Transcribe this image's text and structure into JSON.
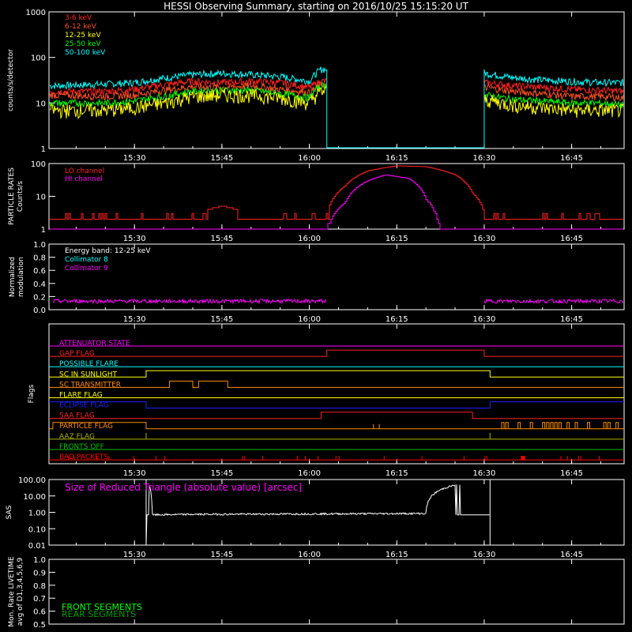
{
  "title": "HESSI Observing Summary, starting on 2016/10/25 15:15:20 UT",
  "colors": {
    "bg": "#000000",
    "axis": "#ffffff",
    "e3_6": "#ff2020",
    "e6_12": "#ff5020",
    "e12_25": "#ffff00",
    "e25_50": "#00ff00",
    "e50_100": "#00ffff",
    "magenta": "#ff00ff",
    "blue": "#2020ff",
    "orange": "#ff8c00",
    "olive": "#b0b000",
    "green": "#00c000",
    "red": "#ff0000",
    "white": "#ffffff",
    "front": "#00ff00",
    "rear": "#00a000"
  },
  "time_ticks": [
    "15:30",
    "15:45",
    "16:00",
    "16:15",
    "16:30",
    "16:45"
  ],
  "chart_data": [
    {
      "id": "spectra",
      "type": "line",
      "ylabel": "counts/s/detector",
      "yscale": "log",
      "ylim": [
        1,
        1000
      ],
      "yticks": [
        "1",
        "10",
        "100",
        "1000"
      ],
      "xlim": [
        "15:15:20",
        "16:54:00"
      ],
      "gap": [
        "16:03",
        "16:30"
      ],
      "series": [
        {
          "name": "3-6 keV",
          "color_key": "e3_6",
          "x": [
            "15:16",
            "15:25",
            "15:30",
            "15:35",
            "15:40",
            "15:45",
            "15:50",
            "15:55",
            "16:00",
            "16:02",
            "16:30",
            "16:35",
            "16:40",
            "16:45",
            "16:50",
            "16:54"
          ],
          "values": [
            18,
            18,
            20,
            25,
            30,
            28,
            30,
            28,
            22,
            30,
            28,
            24,
            22,
            20,
            19,
            18
          ]
        },
        {
          "name": "6-12 keV",
          "color_key": "e6_12",
          "x": [
            "15:16",
            "15:25",
            "15:30",
            "15:35",
            "15:40",
            "15:45",
            "15:50",
            "15:55",
            "16:00",
            "16:02",
            "16:30",
            "16:35",
            "16:40",
            "16:45",
            "16:50",
            "16:54"
          ],
          "values": [
            15,
            14,
            15,
            19,
            23,
            22,
            24,
            20,
            17,
            25,
            22,
            18,
            16,
            14,
            14,
            13
          ]
        },
        {
          "name": "12-25 keV",
          "color_key": "e12_25",
          "x": [
            "15:16",
            "15:25",
            "15:30",
            "15:35",
            "15:40",
            "15:45",
            "15:50",
            "15:55",
            "16:00",
            "16:02",
            "16:30",
            "16:35",
            "16:40",
            "16:45",
            "16:50",
            "16:54"
          ],
          "values": [
            7,
            7,
            8,
            10,
            14,
            15,
            15,
            13,
            10,
            18,
            12,
            9,
            8,
            7,
            7,
            7
          ]
        },
        {
          "name": "25-50 keV",
          "color_key": "e25_50",
          "x": [
            "15:16",
            "15:25",
            "15:30",
            "15:35",
            "15:40",
            "15:45",
            "15:50",
            "15:55",
            "16:00",
            "16:02",
            "16:30",
            "16:35",
            "16:40",
            "16:45",
            "16:50",
            "16:54"
          ],
          "values": [
            10,
            10,
            11,
            14,
            18,
            19,
            19,
            16,
            13,
            24,
            15,
            12,
            11,
            10,
            10,
            9
          ]
        },
        {
          "name": "50-100 keV",
          "color_key": "e50_100",
          "x": [
            "15:16",
            "15:25",
            "15:30",
            "15:35",
            "15:40",
            "15:45",
            "15:50",
            "15:55",
            "16:00",
            "16:02",
            "16:30",
            "16:35",
            "16:40",
            "16:45",
            "16:50",
            "16:54"
          ],
          "values": [
            24,
            26,
            28,
            35,
            42,
            45,
            42,
            38,
            30,
            55,
            45,
            36,
            32,
            30,
            28,
            28
          ]
        }
      ]
    },
    {
      "id": "particle",
      "type": "line",
      "ylabel_lines": [
        "PARTICLE RATES",
        "Counts/s"
      ],
      "yscale": "log",
      "ylim": [
        1,
        100
      ],
      "yticks": [
        "1",
        "10",
        "100"
      ],
      "series": [
        {
          "name": "LO channel",
          "color_key": "e3_6",
          "x": [
            "15:16",
            "15:30",
            "15:40",
            "15:45",
            "15:50",
            "15:55",
            "16:00",
            "16:03",
            "16:06",
            "16:10",
            "16:15",
            "16:20",
            "16:25",
            "16:28",
            "16:30",
            "16:35",
            "16:40",
            "16:50",
            "16:54"
          ],
          "values": [
            2,
            2,
            3,
            5,
            3,
            2.5,
            2.5,
            3,
            20,
            60,
            85,
            80,
            45,
            12,
            3,
            2,
            2,
            2,
            2
          ]
        },
        {
          "name": "HI channel",
          "color_key": "magenta",
          "x": [
            "15:16",
            "16:03",
            "16:06",
            "16:10",
            "16:13",
            "16:17",
            "16:20",
            "16:22",
            "16:22.5",
            "16:54"
          ],
          "values": [
            1,
            1,
            6,
            30,
            45,
            35,
            8,
            1.5,
            1,
            1
          ]
        }
      ]
    },
    {
      "id": "modulation",
      "type": "line",
      "ylabel_lines": [
        "Normalized",
        "modulation"
      ],
      "ylim": [
        0,
        1
      ],
      "yticks": [
        "0.0",
        "0.2",
        "0.4",
        "0.6",
        "0.8",
        "1.0"
      ],
      "annotations": [
        "Energy band: 12-25 keV",
        "Collimator 8",
        "Collimator 9"
      ],
      "series": [
        {
          "name": "Collimator 9",
          "color_key": "magenta",
          "segments": [
            [
              "15:16",
              "16:03"
            ],
            [
              "16:30",
              "16:54"
            ]
          ],
          "values_level": 0.13
        }
      ]
    },
    {
      "id": "flags",
      "type": "line",
      "ylabel": "Flags",
      "series": [
        {
          "name": "ATTENUATOR STATE",
          "color_key": "magenta",
          "transitions": []
        },
        {
          "name": "GAP FLAG",
          "color_key": "e3_6",
          "transitions": [
            [
              "16:03",
              "16:30"
            ]
          ]
        },
        {
          "name": "POSSIBLE FLARE",
          "color_key": "e50_100",
          "transitions": []
        },
        {
          "name": "SC IN SUNLIGHT",
          "color_key": "e12_25",
          "transitions": [
            [
              "15:32",
              "16:31"
            ]
          ]
        },
        {
          "name": "SC TRANSMITTER",
          "color_key": "orange",
          "transitions": [
            [
              "15:36",
              "15:40"
            ],
            [
              "15:41",
              "15:46"
            ]
          ]
        },
        {
          "name": "FLARE FLAG",
          "color_key": "e12_25",
          "transitions": []
        },
        {
          "name": "ECLIPSE FLAG",
          "color_key": "blue",
          "inverted": true,
          "transitions": [
            [
              "15:32",
              "16:31"
            ]
          ]
        },
        {
          "name": "SAA FLAG",
          "color_key": "e3_6",
          "transitions": [
            [
              "16:02",
              "16:28"
            ]
          ]
        },
        {
          "name": "PARTICLE FLAG",
          "color_key": "orange",
          "transitions": [
            [
              "15:16",
              "15:32"
            ]
          ]
        },
        {
          "name": "AAZ FLAG",
          "color_key": "olive",
          "transitions": []
        },
        {
          "name": "FRONTS OFF",
          "color_key": "green",
          "transitions": []
        },
        {
          "name": "BAD PACKETS",
          "color_key": "red",
          "transitions": []
        }
      ]
    },
    {
      "id": "sas",
      "type": "line",
      "ylabel": "SAS",
      "yscale": "log",
      "ylim": [
        0.01,
        100
      ],
      "yticks": [
        "0.01",
        "0.10",
        "1.00",
        "10.00",
        "100.00"
      ],
      "annotation": "Size of Reduced Triangle (absolute value) [arcsec]",
      "series": [
        {
          "name": "Size of Reduced Triangle",
          "color_key": "white",
          "x": [
            "15:32",
            "15:33",
            "15:40",
            "16:00",
            "16:20",
            "16:31"
          ],
          "values": [
            100,
            0.7,
            0.75,
            0.8,
            0.85,
            100
          ]
        }
      ]
    },
    {
      "id": "livetime",
      "type": "line",
      "ylabel_lines": [
        "Mon. Rate LIVETIME",
        "avg of D1,3,4,5,6,9"
      ],
      "ylim": [
        0.5,
        1.0
      ],
      "yticks": [
        "0.5",
        "0.6",
        "0.7",
        "0.8",
        "0.9",
        "1.0"
      ],
      "legend": [
        "FRONT SEGMENTS",
        "REAR SEGMENTS"
      ],
      "series": []
    }
  ],
  "spectra_legend": [
    "3-6 keV",
    "6-12 keV",
    "12-25 keV",
    "25-50 keV",
    "50-100 keV"
  ],
  "particle_legend": [
    "LO channel",
    "HI channel"
  ]
}
